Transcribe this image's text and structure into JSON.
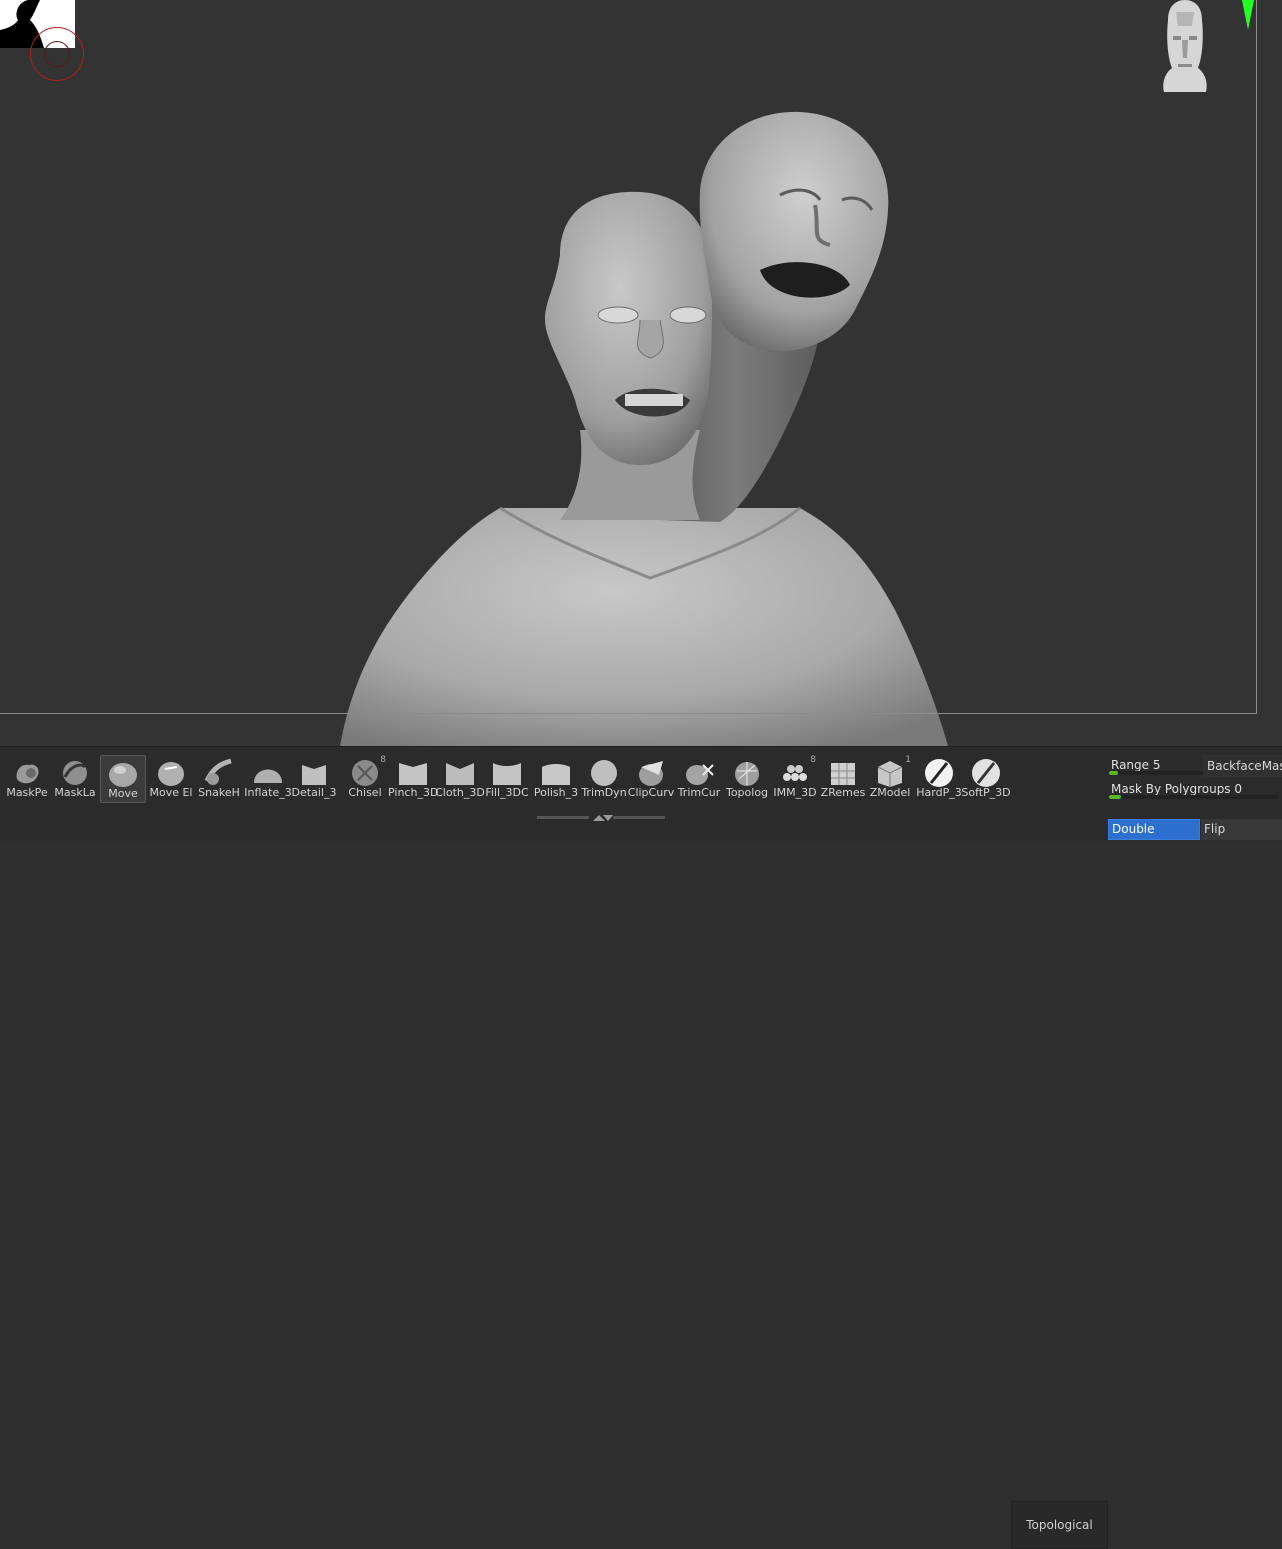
{
  "viewport": {
    "background": "#333333",
    "thumbnail_icon": "silhouette-thumbnail",
    "navigation_icon": "head-orientation-icon",
    "gizmo_icon": "y-axis-arrow-icon",
    "axis_color": "#22ff22",
    "cursor_color": "#b02020"
  },
  "brush_shelf": {
    "brushes": [
      {
        "label": "MaskPe",
        "icon": "mask-pen-icon"
      },
      {
        "label": "MaskLa",
        "icon": "mask-lasso-icon"
      },
      {
        "label": "Move",
        "icon": "move-brush-icon",
        "active": true
      },
      {
        "label": "Move El",
        "icon": "move-elastic-icon"
      },
      {
        "label": "SnakeH",
        "icon": "snake-hook-icon"
      },
      {
        "label": "Inflate_3",
        "icon": "inflate-icon"
      },
      {
        "label": "Detail_3",
        "icon": "detail-icon"
      },
      {
        "label": "Chisel",
        "icon": "chisel-icon",
        "count": "8"
      },
      {
        "label": "Pinch_3D",
        "icon": "pinch-icon"
      },
      {
        "label": "Cloth_3D",
        "icon": "cloth-icon"
      },
      {
        "label": "Fill_3DC",
        "icon": "fill-icon"
      },
      {
        "label": "Polish_3",
        "icon": "polish-icon"
      },
      {
        "label": "TrimDyn",
        "icon": "trim-dynamic-icon"
      },
      {
        "label": "ClipCurv",
        "icon": "clip-curve-icon"
      },
      {
        "label": "TrimCur",
        "icon": "trim-curve-icon"
      },
      {
        "label": "Topolog",
        "icon": "topology-icon"
      },
      {
        "label": "IMM_3D",
        "icon": "imm-icon",
        "count": "8"
      },
      {
        "label": "ZRemes",
        "icon": "zremesher-icon"
      },
      {
        "label": "ZModel",
        "icon": "zmodeler-icon",
        "count": "1"
      },
      {
        "label": "HardP_3",
        "icon": "hard-polish-icon"
      },
      {
        "label": "SoftP_3D",
        "icon": "soft-polish-icon"
      }
    ],
    "grip_icon": "shelf-resize-arrows-icon"
  },
  "options": {
    "topological_label": "Topological",
    "range_label": "Range",
    "range_value": "5",
    "range_fraction": 0.1,
    "mask_by_polygroups_label": "Mask By Polygroups",
    "mask_by_polygroups_value": "0",
    "mask_by_polygroups_fraction": 0.0,
    "backface_label": "BackfaceMas",
    "double_label": "Double",
    "flip_label": "Flip",
    "accent_color": "#2c6fcf",
    "slider_color": "#58b81e"
  }
}
